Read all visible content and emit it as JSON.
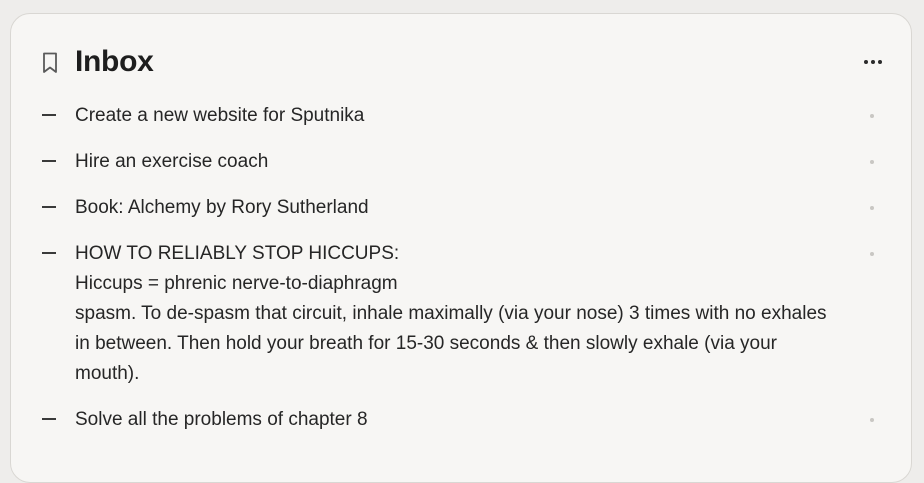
{
  "inbox": {
    "title": "Inbox",
    "bookmark_icon": "bookmark-icon",
    "more_icon": "more-horizontal-icon",
    "items": [
      {
        "lines": [
          "Create a new website for Sputnika"
        ]
      },
      {
        "lines": [
          "Hire an exercise coach"
        ]
      },
      {
        "lines": [
          "Book: Alchemy by Rory Sutherland"
        ]
      },
      {
        "lines": [
          "HOW TO RELIABLY STOP HICCUPS:",
          "Hiccups = phrenic nerve-to-diaphragm",
          "spasm. To de-spasm that circuit, inhale maximally (via your nose) 3 times with no exhales in between. Then hold your breath for 15-30 seconds & then slowly exhale (via your mouth)."
        ]
      },
      {
        "lines": [
          "Solve all the problems of chapter 8"
        ]
      }
    ]
  }
}
